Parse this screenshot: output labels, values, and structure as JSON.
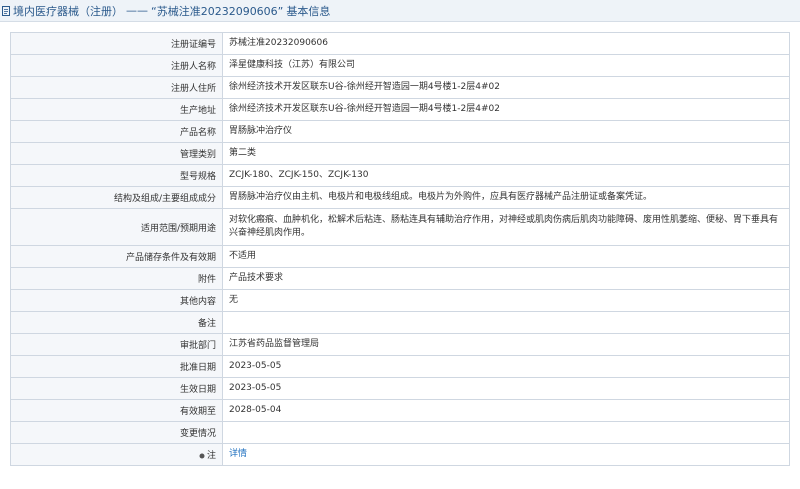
{
  "header": {
    "breadcrumb_root": "境内医疗器械（注册）",
    "separator": "——",
    "title_quoted": "“苏械注准20232090606”",
    "title_suffix": "基本信息"
  },
  "rows": [
    {
      "label": "注册证编号",
      "value": "苏械注准20232090606"
    },
    {
      "label": "注册人名称",
      "value": "泽星健康科技（江苏）有限公司"
    },
    {
      "label": "注册人住所",
      "value": "徐州经济技术开发区联东U谷-徐州经开智造园一期4号楼1-2层4#02"
    },
    {
      "label": "生产地址",
      "value": "徐州经济技术开发区联东U谷-徐州经开智造园一期4号楼1-2层4#02"
    },
    {
      "label": "产品名称",
      "value": "胃肠脉冲治疗仪"
    },
    {
      "label": "管理类别",
      "value": "第二类"
    },
    {
      "label": "型号规格",
      "value": "ZCJK-180、ZCJK-150、ZCJK-130"
    },
    {
      "label": "结构及组成/主要组成成分",
      "value": "胃肠脉冲治疗仪由主机、电极片和电极线组成。电极片为外购件，应具有医疗器械产品注册证或备案凭证。"
    },
    {
      "label": "适用范围/预期用途",
      "value": "对软化瘢痕、血肿机化，松解术后粘连、肠粘连具有辅助治疗作用，对神经或肌肉伤病后肌肉功能障碍、废用性肌萎缩、便秘、胃下垂具有兴奋神经肌肉作用。"
    },
    {
      "label": "产品储存条件及有效期",
      "value": "不适用"
    },
    {
      "label": "附件",
      "value": "产品技术要求"
    },
    {
      "label": "其他内容",
      "value": "无"
    },
    {
      "label": "备注",
      "value": ""
    },
    {
      "label": "审批部门",
      "value": "江苏省药品监督管理局"
    },
    {
      "label": "批准日期",
      "value": "2023-05-05"
    },
    {
      "label": "生效日期",
      "value": "2023-05-05"
    },
    {
      "label": "有效期至",
      "value": "2028-05-04"
    },
    {
      "label": "变更情况",
      "value": ""
    },
    {
      "label": "注",
      "value": "详情"
    }
  ],
  "colors": {
    "header_bg": "#eef3f8",
    "header_text": "#2b5a8c",
    "label_bg": "#f5f7fa",
    "border": "#cfd7e1",
    "link": "#1e6fbf"
  },
  "icons": {
    "header": "document-icon",
    "note": "pin-icon"
  }
}
